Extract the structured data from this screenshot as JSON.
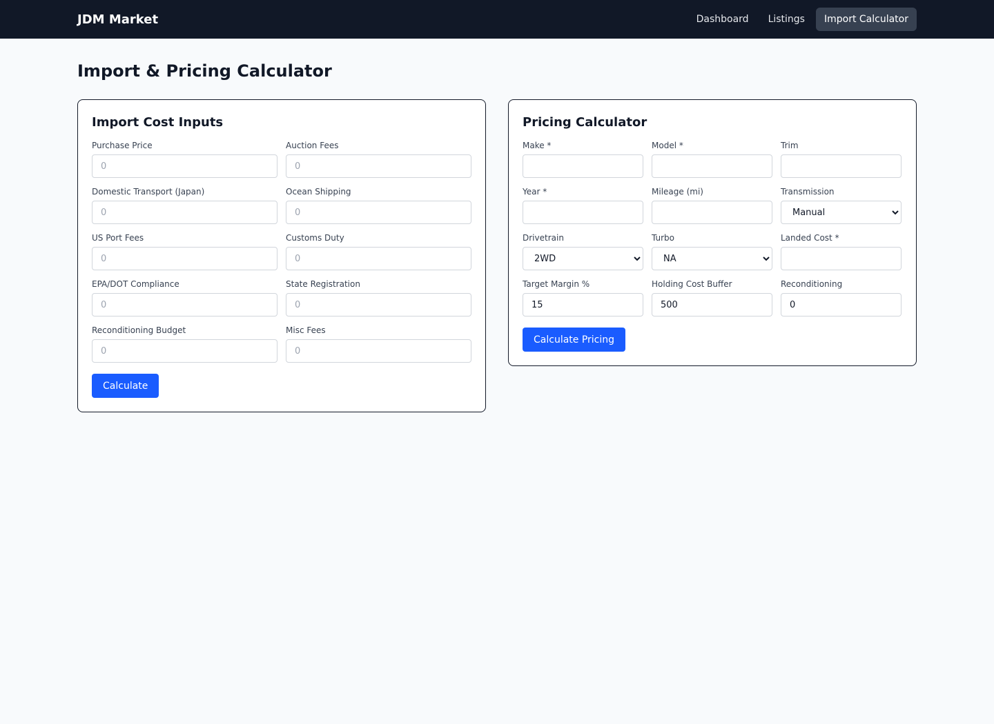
{
  "header": {
    "brand": "JDM Market",
    "nav": [
      {
        "label": "Dashboard",
        "active": false
      },
      {
        "label": "Listings",
        "active": false
      },
      {
        "label": "Import Calculator",
        "active": true
      }
    ]
  },
  "page": {
    "title": "Import & Pricing Calculator"
  },
  "import_card": {
    "title": "Import Cost Inputs",
    "fields": [
      {
        "label": "Purchase Price",
        "placeholder": "0",
        "value": ""
      },
      {
        "label": "Auction Fees",
        "placeholder": "0",
        "value": ""
      },
      {
        "label": "Domestic Transport (Japan)",
        "placeholder": "0",
        "value": ""
      },
      {
        "label": "Ocean Shipping",
        "placeholder": "0",
        "value": ""
      },
      {
        "label": "US Port Fees",
        "placeholder": "0",
        "value": ""
      },
      {
        "label": "Customs Duty",
        "placeholder": "0",
        "value": ""
      },
      {
        "label": "EPA/DOT Compliance",
        "placeholder": "0",
        "value": ""
      },
      {
        "label": "State Registration",
        "placeholder": "0",
        "value": ""
      },
      {
        "label": "Reconditioning Budget",
        "placeholder": "0",
        "value": ""
      },
      {
        "label": "Misc Fees",
        "placeholder": "0",
        "value": ""
      }
    ],
    "button_label": "Calculate"
  },
  "pricing_card": {
    "title": "Pricing Calculator",
    "make": {
      "label": "Make *",
      "value": ""
    },
    "model": {
      "label": "Model *",
      "value": ""
    },
    "trim": {
      "label": "Trim",
      "value": ""
    },
    "year": {
      "label": "Year *",
      "value": ""
    },
    "mileage": {
      "label": "Mileage (mi)",
      "value": ""
    },
    "transmission": {
      "label": "Transmission",
      "selected": "Manual"
    },
    "drivetrain": {
      "label": "Drivetrain",
      "selected": "2WD"
    },
    "turbo": {
      "label": "Turbo",
      "selected": "NA"
    },
    "landed_cost": {
      "label": "Landed Cost *",
      "value": ""
    },
    "target_margin": {
      "label": "Target Margin %",
      "value": "15"
    },
    "holding_cost": {
      "label": "Holding Cost Buffer",
      "value": "500"
    },
    "reconditioning": {
      "label": "Reconditioning",
      "value": "0"
    },
    "button_label": "Calculate Pricing"
  }
}
